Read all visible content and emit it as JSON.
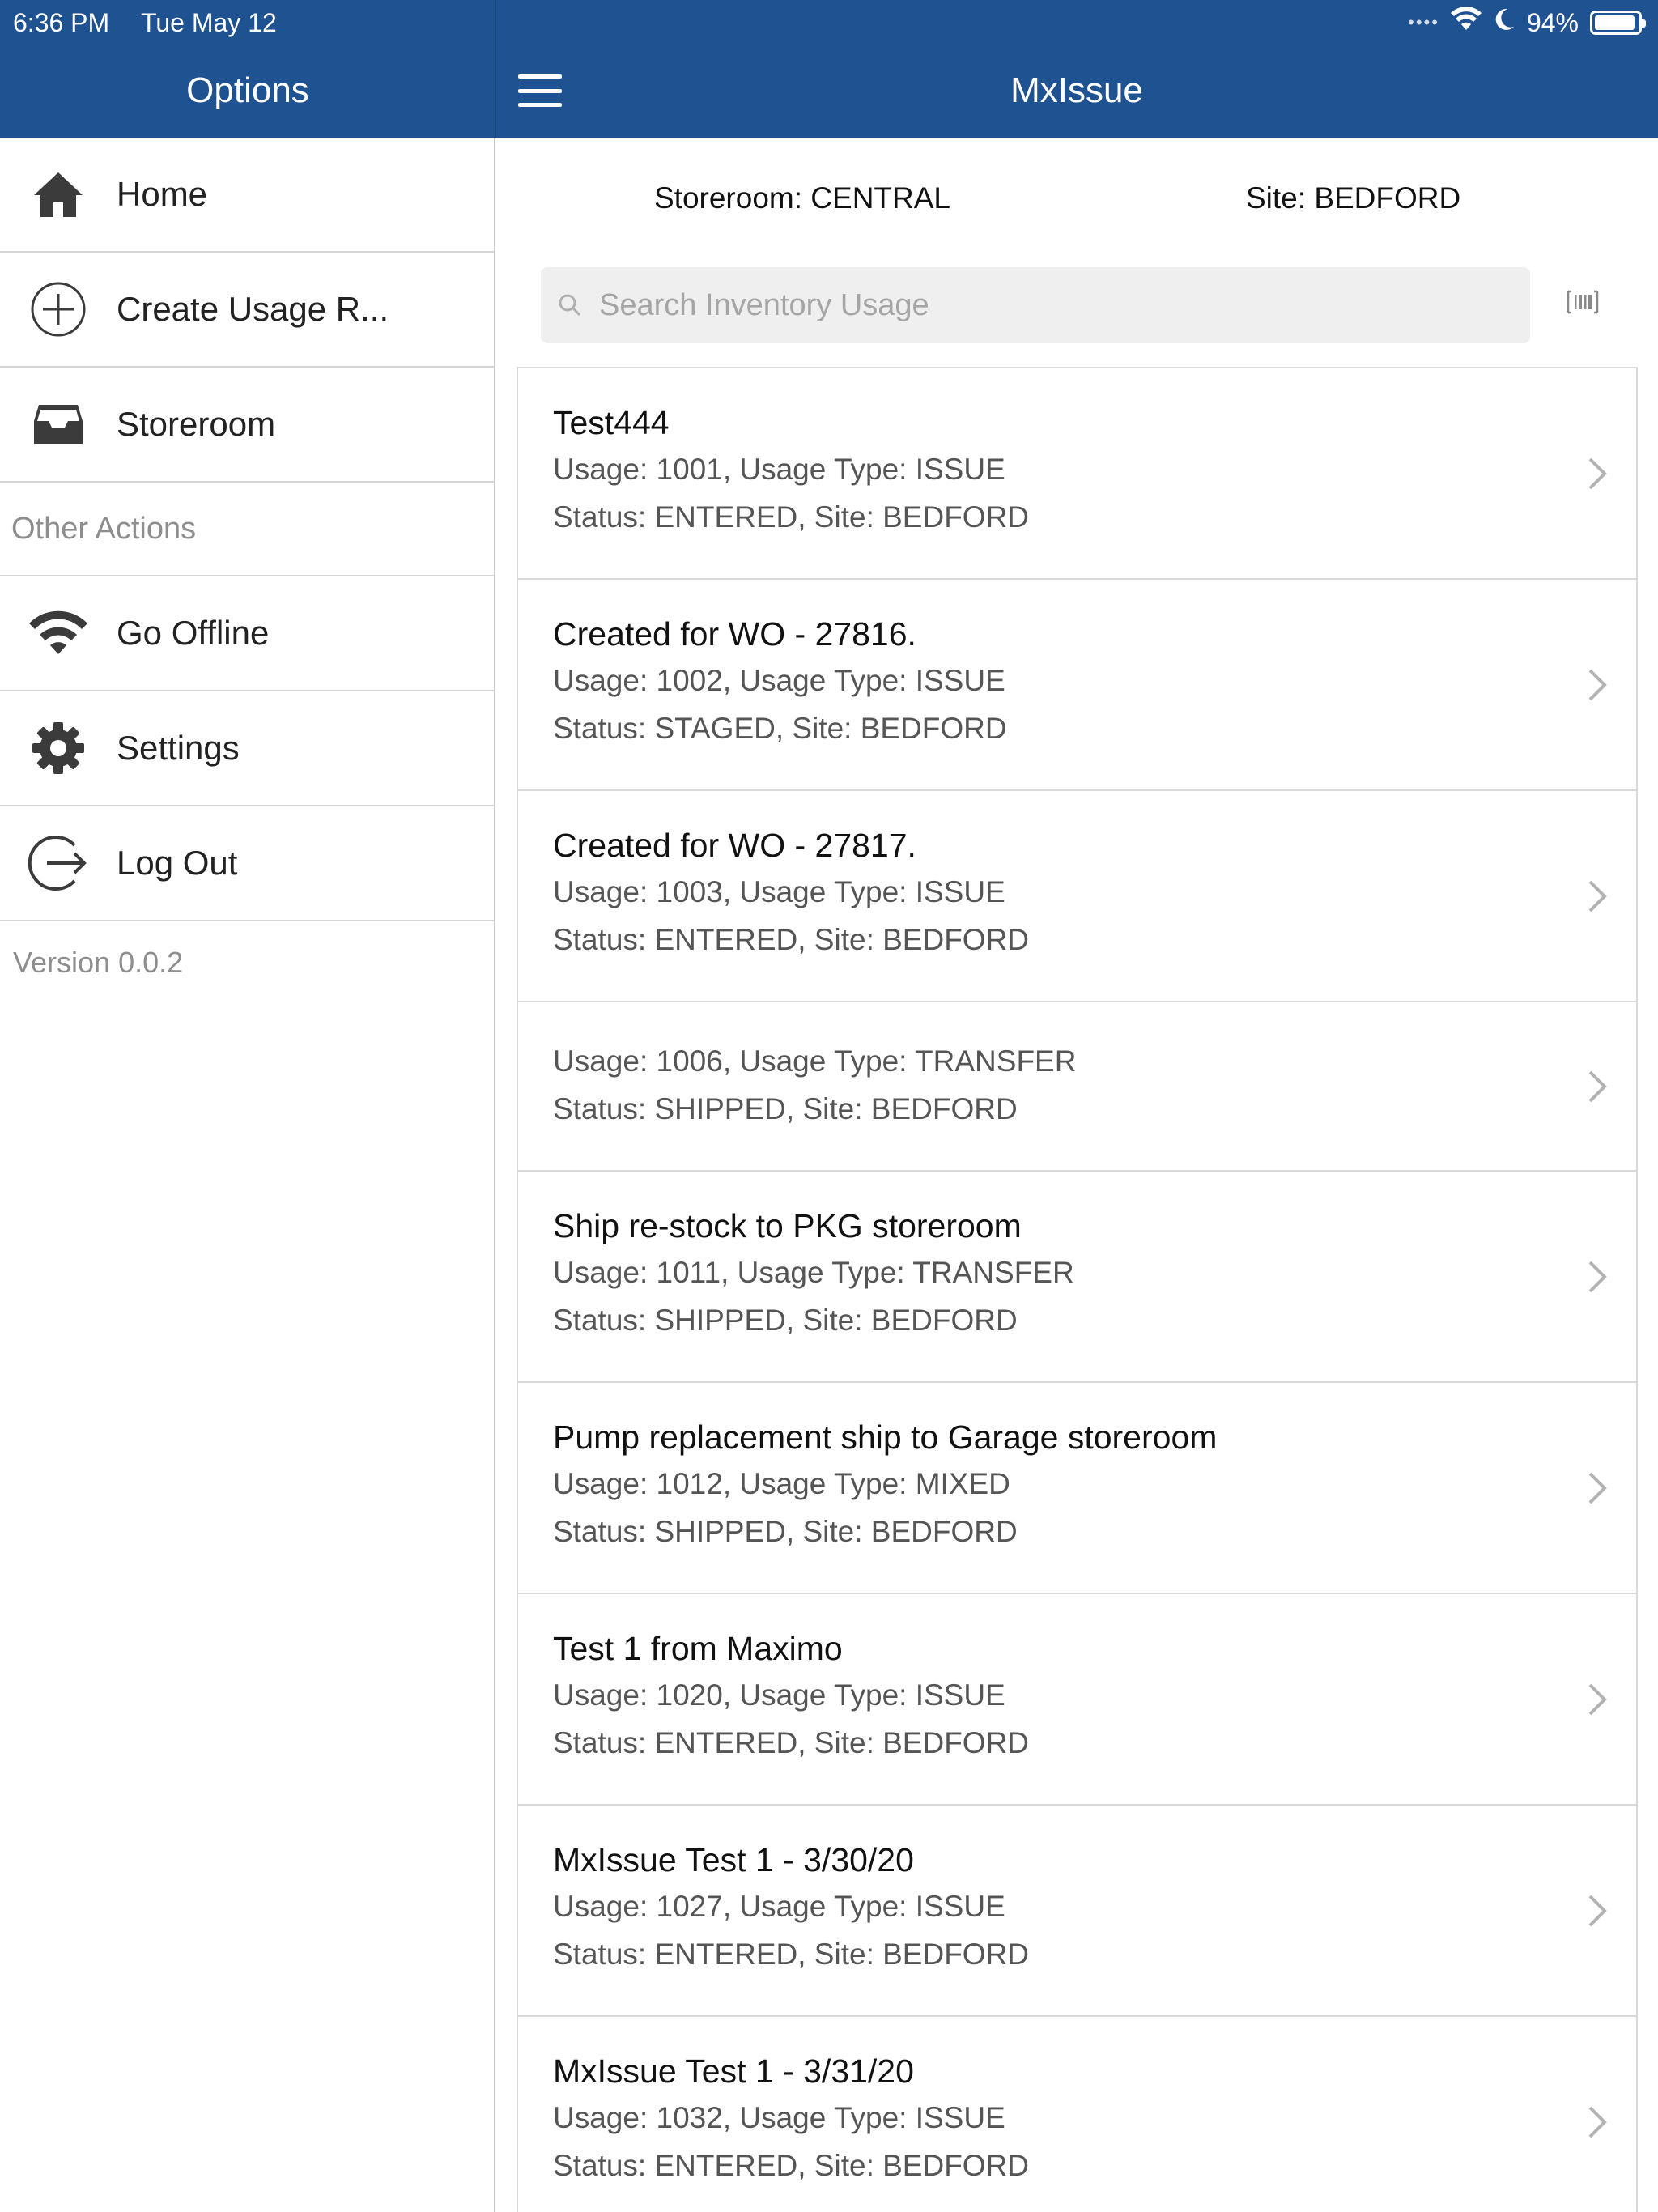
{
  "status_bar": {
    "time": "6:36 PM",
    "date": "Tue May 12",
    "battery": "94%",
    "battery_level": 0.94
  },
  "sidebar": {
    "title": "Options",
    "items": [
      {
        "label": "Home",
        "icon": "home-icon"
      },
      {
        "label": "Create Usage R...",
        "icon": "plus-circle-icon"
      },
      {
        "label": "Storeroom",
        "icon": "inbox-icon"
      }
    ],
    "section_label": "Other Actions",
    "actions": [
      {
        "label": "Go Offline",
        "icon": "wifi-icon"
      },
      {
        "label": "Settings",
        "icon": "gear-icon"
      },
      {
        "label": "Log Out",
        "icon": "logout-icon"
      }
    ],
    "version": "Version 0.0.2"
  },
  "header": {
    "title": "MxIssue"
  },
  "main": {
    "storeroom": "Storeroom: CENTRAL",
    "site": "Site: BEDFORD",
    "search": {
      "placeholder": "Search Inventory Usage",
      "value": ""
    },
    "records": [
      {
        "title": "Test444",
        "line1": "Usage: 1001, Usage Type: ISSUE",
        "line2": "Status: ENTERED, Site: BEDFORD"
      },
      {
        "title": "Created for WO - 27816.",
        "line1": "Usage: 1002, Usage Type: ISSUE",
        "line2": "Status: STAGED, Site: BEDFORD"
      },
      {
        "title": "Created for WO - 27817.",
        "line1": "Usage: 1003, Usage Type: ISSUE",
        "line2": "Status: ENTERED, Site: BEDFORD"
      },
      {
        "title": "",
        "line1": "Usage: 1006, Usage Type: TRANSFER",
        "line2": "Status: SHIPPED, Site: BEDFORD"
      },
      {
        "title": "Ship re-stock to PKG storeroom",
        "line1": "Usage: 1011, Usage Type: TRANSFER",
        "line2": "Status: SHIPPED, Site: BEDFORD"
      },
      {
        "title": "Pump replacement ship to Garage storeroom",
        "line1": "Usage: 1012, Usage Type: MIXED",
        "line2": "Status: SHIPPED, Site: BEDFORD"
      },
      {
        "title": "Test 1 from Maximo",
        "line1": "Usage: 1020, Usage Type: ISSUE",
        "line2": "Status: ENTERED, Site: BEDFORD"
      },
      {
        "title": "MxIssue Test 1 - 3/30/20",
        "line1": "Usage: 1027, Usage Type: ISSUE",
        "line2": "Status: ENTERED, Site: BEDFORD"
      },
      {
        "title": "MxIssue Test 1 - 3/31/20",
        "line1": "Usage: 1032, Usage Type: ISSUE",
        "line2": "Status: ENTERED, Site: BEDFORD"
      }
    ]
  },
  "colors": {
    "header_blue": "#1f5291",
    "divider": "#d4d4d4",
    "secondary_text": "#555555",
    "muted_text": "#8e8e8e"
  }
}
